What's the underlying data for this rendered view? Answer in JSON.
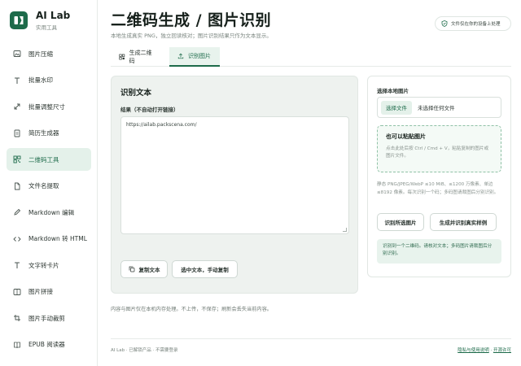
{
  "brand": {
    "title": "AI Lab",
    "subtitle": "实用工具"
  },
  "sidebar": {
    "items": [
      {
        "label": "图片压缩",
        "icon": "image-icon"
      },
      {
        "label": "批量水印",
        "icon": "text-icon"
      },
      {
        "label": "批量调整尺寸",
        "icon": "resize-icon"
      },
      {
        "label": "简历生成器",
        "icon": "document-icon"
      },
      {
        "label": "二维码工具",
        "icon": "qrcode-icon",
        "active": true
      },
      {
        "label": "文件名提取",
        "icon": "file-icon"
      },
      {
        "label": "Markdown 编辑",
        "icon": "pen-icon"
      },
      {
        "label": "Markdown 转 HTML",
        "icon": "code-icon"
      },
      {
        "label": "文字转卡片",
        "icon": "text-card-icon"
      },
      {
        "label": "图片拼接",
        "icon": "grid-icon"
      },
      {
        "label": "图片手动裁剪",
        "icon": "crop-icon"
      },
      {
        "label": "EPUB 阅读器",
        "icon": "book-icon"
      }
    ]
  },
  "header": {
    "title": "二维码生成 / 图片识别",
    "subtitle": "本地生成真实 PNG，独立回读核对；图片识别结果只作为文本显示。",
    "privacy_badge": "文件仅在你的设备上处理"
  },
  "tabs": [
    {
      "label": "生成二维码",
      "icon": "qrcode-icon"
    },
    {
      "label": "识别图片",
      "icon": "upload-icon",
      "active": true
    }
  ],
  "recognize": {
    "panel_title": "识别文本",
    "result_label": "结果（不自动打开链接）",
    "result_value": "https://ailab.packscena.com/",
    "copy_button": "复制文本",
    "select_button": "选中文本，手动复制",
    "note": "内容与图片仅在本机内存处理。不上传，不保存；刷新会丢失当前内容。"
  },
  "upload": {
    "label": "选择本地图片",
    "file_button": "选择文件",
    "file_status": "未选择任何文件",
    "paste_title": "也可以粘贴图片",
    "paste_desc": "点击此处后按 Ctrl / Cmd + V，粘贴复制的图片或图片文件。",
    "hint": "静态 PNG/JPEG/WebP ≤10 MiB、≤1200 万像素、单边≤8192 像素。每次识别一个码；多码图请裁图后分别识别。",
    "recognize_button": "识别所选图片",
    "sample_button": "生成并识别真实样例",
    "info": "识别到一个二维码。请核对文本；多码图片请裁图后分别识别。"
  },
  "footer": {
    "left": "AI Lab · 已解锁产品 · 不需要登录",
    "privacy_link": "隐私与使用说明",
    "source_link": "开源许可"
  },
  "colors": {
    "accent": "#1d6b4a",
    "accent_light": "#e4f1ea",
    "panel_bg": "#eef2ef"
  }
}
